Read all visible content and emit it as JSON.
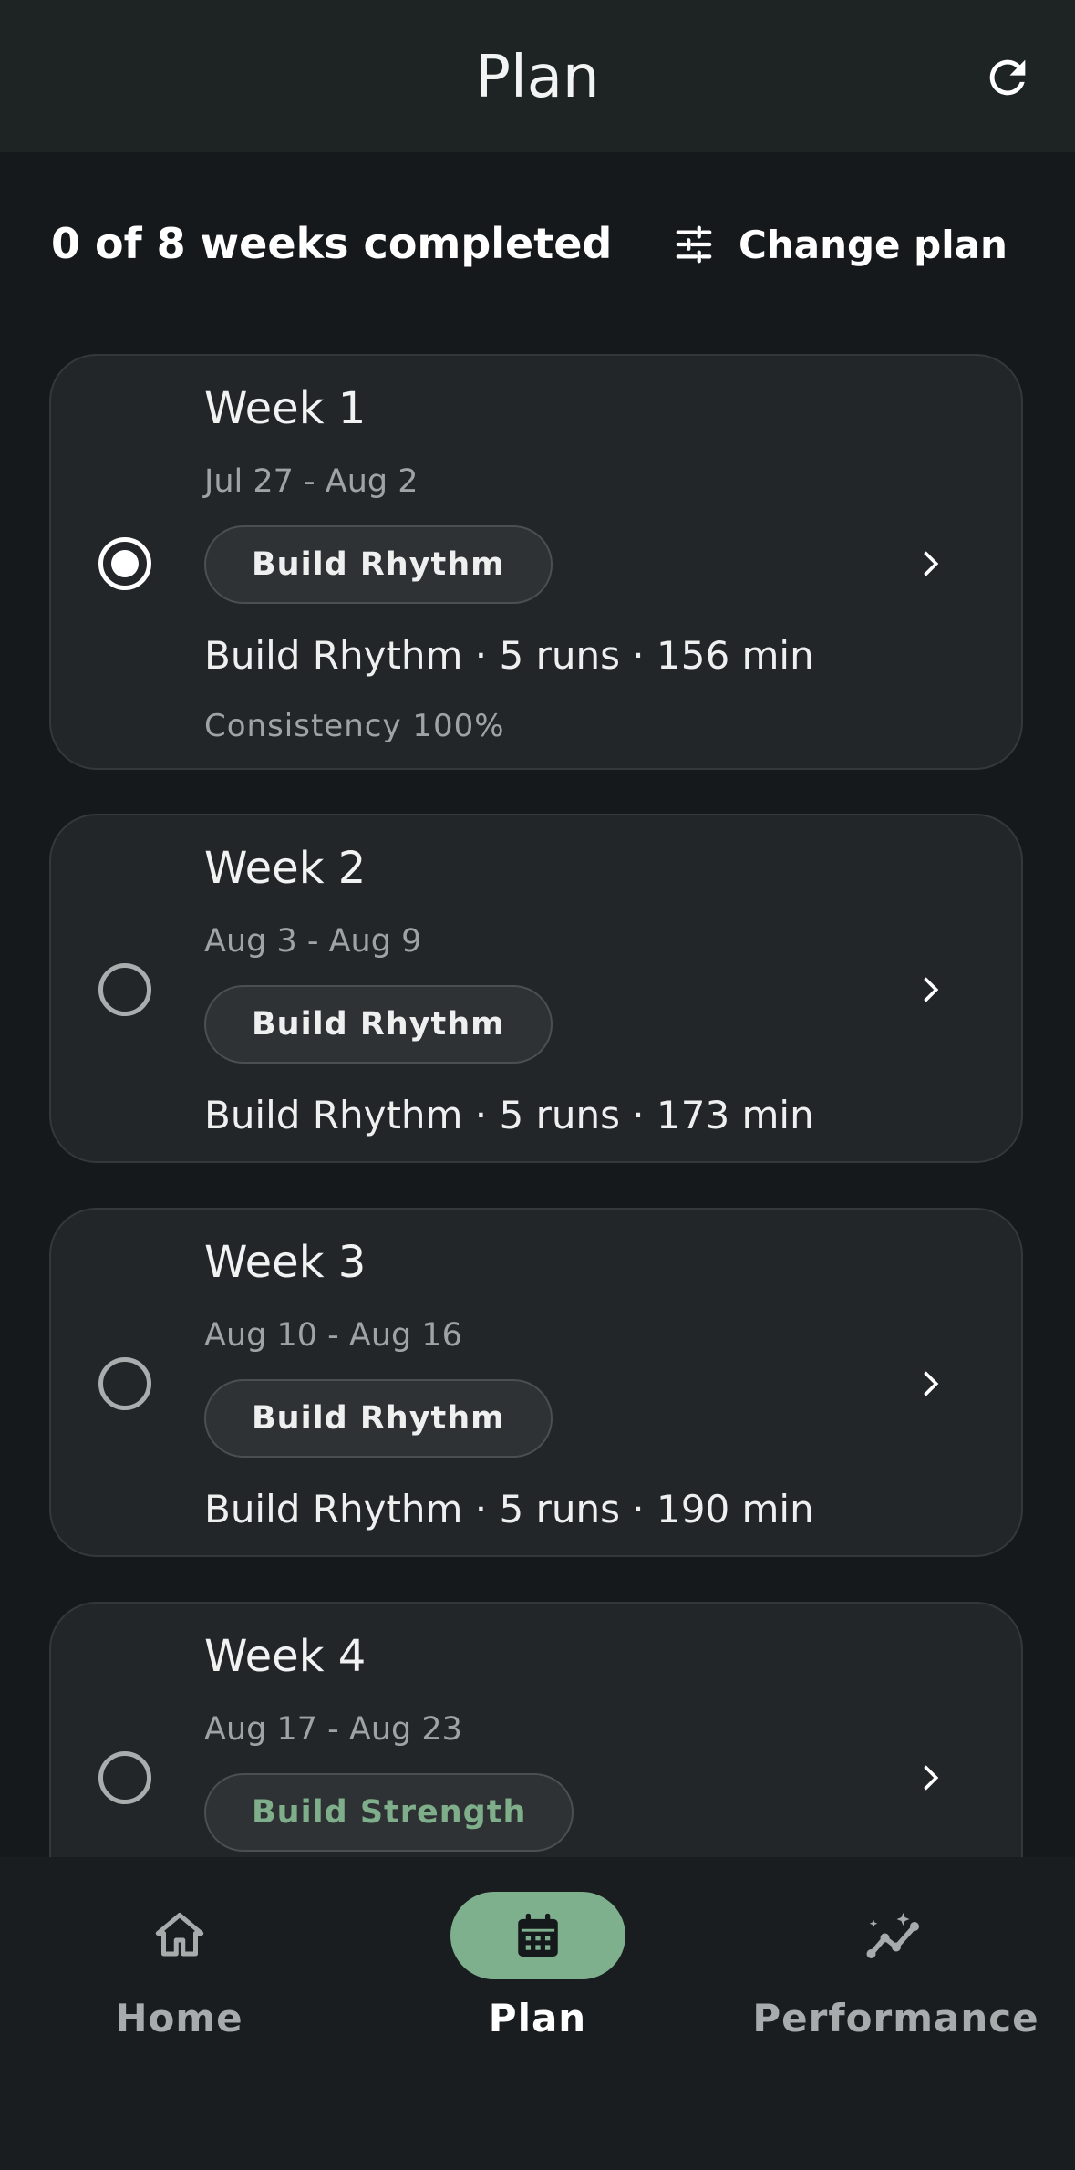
{
  "header": {
    "title": "Plan",
    "refresh_icon": "refresh-icon"
  },
  "summary": {
    "text": "0 of 8 weeks completed"
  },
  "change_plan": {
    "label": "Change plan",
    "icon": "sliders-icon"
  },
  "weeks": [
    {
      "title": "Week 1",
      "dates": "Jul 27 - Aug 2",
      "chip": "Build Rhythm",
      "summary": "Build Rhythm · 5 runs · 156 min",
      "consistency": "Consistency 100%",
      "selected": true
    },
    {
      "title": "Week 2",
      "dates": "Aug 3 - Aug 9",
      "chip": "Build Rhythm",
      "summary": "Build Rhythm · 5 runs · 173 min",
      "selected": false
    },
    {
      "title": "Week 3",
      "dates": "Aug 10 - Aug 16",
      "chip": "Build Rhythm",
      "summary": "Build Rhythm · 5 runs · 190 min",
      "selected": false
    },
    {
      "title": "Week 4",
      "dates": "Aug 17 - Aug 23",
      "chip": "Build Strength",
      "selected": false
    }
  ],
  "nav": [
    {
      "label": "Home",
      "icon": "home-icon"
    },
    {
      "label": "Plan",
      "icon": "calendar-icon",
      "active": true
    },
    {
      "label": "Performance",
      "icon": "trend-sparkle-icon"
    }
  ],
  "colors": {
    "background": "#16191c",
    "card": "#232628",
    "accent_green": "#7fb08e",
    "strength_chip_text": "#7fae8a"
  }
}
